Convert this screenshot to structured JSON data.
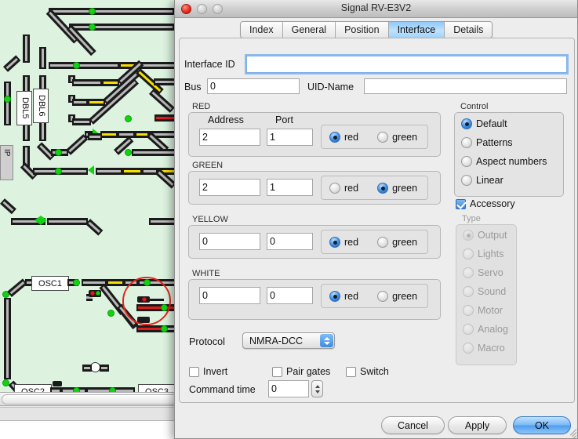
{
  "window": {
    "title": "Signal RV-E3V2",
    "traffic_lights": [
      "close-button",
      "minimize-button",
      "zoom-button"
    ]
  },
  "tabs": [
    {
      "label": "Index",
      "active": false
    },
    {
      "label": "General",
      "active": false
    },
    {
      "label": "Position",
      "active": false
    },
    {
      "label": "Interface",
      "active": true
    },
    {
      "label": "Details",
      "active": false
    }
  ],
  "form": {
    "interface_id": {
      "label": "Interface ID",
      "value": "",
      "focused": true
    },
    "bus": {
      "label": "Bus",
      "value": "0"
    },
    "uid_name": {
      "label": "UID-Name",
      "value": ""
    },
    "column_headers": {
      "address": "Address",
      "port": "Port"
    },
    "aspects": [
      {
        "name": "RED",
        "address": "2",
        "port": "1",
        "red_selected": true,
        "green_selected": false
      },
      {
        "name": "GREEN",
        "address": "2",
        "port": "1",
        "red_selected": false,
        "green_selected": true
      },
      {
        "name": "YELLOW",
        "address": "0",
        "port": "0",
        "red_selected": true,
        "green_selected": false
      },
      {
        "name": "WHITE",
        "address": "0",
        "port": "0",
        "red_selected": true,
        "green_selected": false
      }
    ],
    "radio_labels": {
      "red": "red",
      "green": "green"
    },
    "protocol": {
      "label": "Protocol",
      "value": "NMRA-DCC"
    },
    "invert": {
      "label": "Invert",
      "checked": false
    },
    "pair_gates": {
      "label": "Pair gates",
      "checked": false
    },
    "switch": {
      "label": "Switch",
      "checked": false
    },
    "command_time": {
      "label": "Command time",
      "value": "0"
    }
  },
  "control": {
    "title": "Control",
    "options": [
      {
        "label": "Default",
        "selected": true
      },
      {
        "label": "Patterns",
        "selected": false
      },
      {
        "label": "Aspect numbers",
        "selected": false
      },
      {
        "label": "Linear",
        "selected": false
      }
    ],
    "accessory": {
      "label": "Accessory",
      "checked": true
    }
  },
  "type": {
    "title": "Type",
    "disabled": true,
    "options": [
      {
        "label": "Output",
        "selected": true
      },
      {
        "label": "Lights",
        "selected": false
      },
      {
        "label": "Servo",
        "selected": false
      },
      {
        "label": "Sound",
        "selected": false
      },
      {
        "label": "Motor",
        "selected": false
      },
      {
        "label": "Analog",
        "selected": false
      },
      {
        "label": "Macro",
        "selected": false
      }
    ]
  },
  "buttons": {
    "cancel": "Cancel",
    "apply": "Apply",
    "ok": "OK"
  },
  "track_plan": {
    "block_labels": [
      "DBL5",
      "DBL6",
      "IP",
      "OSC1",
      "OSC2",
      "OSC3"
    ],
    "colors": {
      "background": "#ddf3e0",
      "rail": "#b8b8b8",
      "sleeper": "#1a1a1a",
      "sensor_green": "#12d312",
      "occupied_red": "#e01b1b",
      "reserved_yellow": "#f5e000",
      "highlight_circle": "#e8231a"
    }
  }
}
